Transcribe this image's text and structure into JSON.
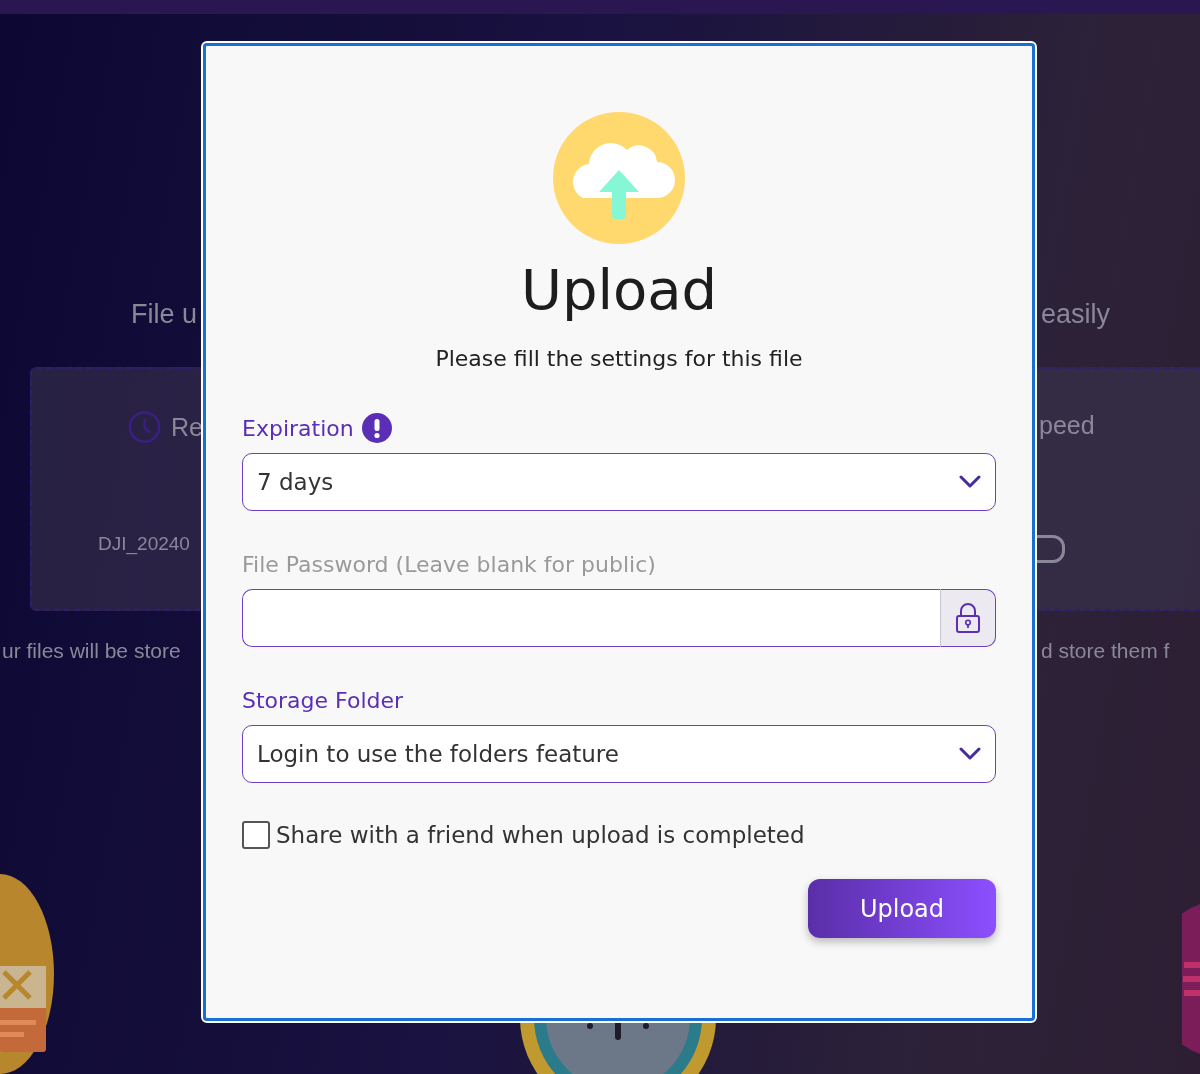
{
  "background": {
    "heading_left": "File u",
    "heading_right": "easily",
    "card_left": {
      "title": "Re",
      "filename": "DJI_20240"
    },
    "card_right": {
      "title": "peed"
    },
    "footer_left": "ur files will be store",
    "footer_right": "d store them f"
  },
  "dialog": {
    "title": "Upload",
    "subtitle": "Please fill the settings for this file",
    "fields": [
      {
        "kind": "select",
        "label": "Expiration",
        "accent": true,
        "info": true,
        "value": "7 days"
      },
      {
        "kind": "password",
        "label": "File Password (Leave blank for public)",
        "accent": false,
        "info": false
      },
      {
        "kind": "select",
        "label": "Storage Folder",
        "accent": true,
        "info": false,
        "value": "Login to use the folders feature"
      }
    ],
    "share_checkbox": {
      "label": "Share with a friend when upload is completed",
      "checked": false
    },
    "submit": "Upload"
  }
}
